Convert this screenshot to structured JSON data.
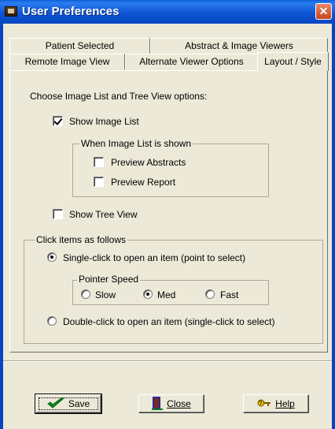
{
  "window": {
    "title": "User Preferences",
    "close_glyph": "✕"
  },
  "tabs": {
    "row1": [
      {
        "label": "Patient Selected"
      },
      {
        "label": "Abstract & Image Viewers"
      }
    ],
    "row2": [
      {
        "label": "Remote Image View"
      },
      {
        "label": "Alternate Viewer Options"
      },
      {
        "label": "Layout / Style",
        "active": true
      }
    ]
  },
  "layout": {
    "intro": "Choose Image List and Tree View options:",
    "show_image_list": {
      "label": "Show Image List",
      "checked": true
    },
    "image_list_group": {
      "title": "When Image List is shown",
      "preview_abstracts": {
        "label": "Preview Abstracts",
        "checked": false
      },
      "preview_report": {
        "label": "Preview Report",
        "checked": false
      }
    },
    "show_tree_view": {
      "label": "Show Tree View",
      "checked": false
    },
    "click_group": {
      "title": "Click items as follows",
      "single_click": {
        "label": "Single-click to open an item (point to select)",
        "selected": true
      },
      "pointer_speed": {
        "title": "Pointer Speed",
        "options": [
          {
            "label": "Slow",
            "selected": false
          },
          {
            "label": "Med",
            "selected": true
          },
          {
            "label": "Fast",
            "selected": false
          }
        ]
      },
      "double_click": {
        "label": "Double-click to open an item (single-click to select)",
        "selected": false
      }
    }
  },
  "buttons": {
    "save": "Save",
    "close": "Close",
    "help": "Help"
  },
  "icons": {
    "save": "checkmark-icon",
    "close": "door-icon",
    "help": "help-key-icon"
  }
}
